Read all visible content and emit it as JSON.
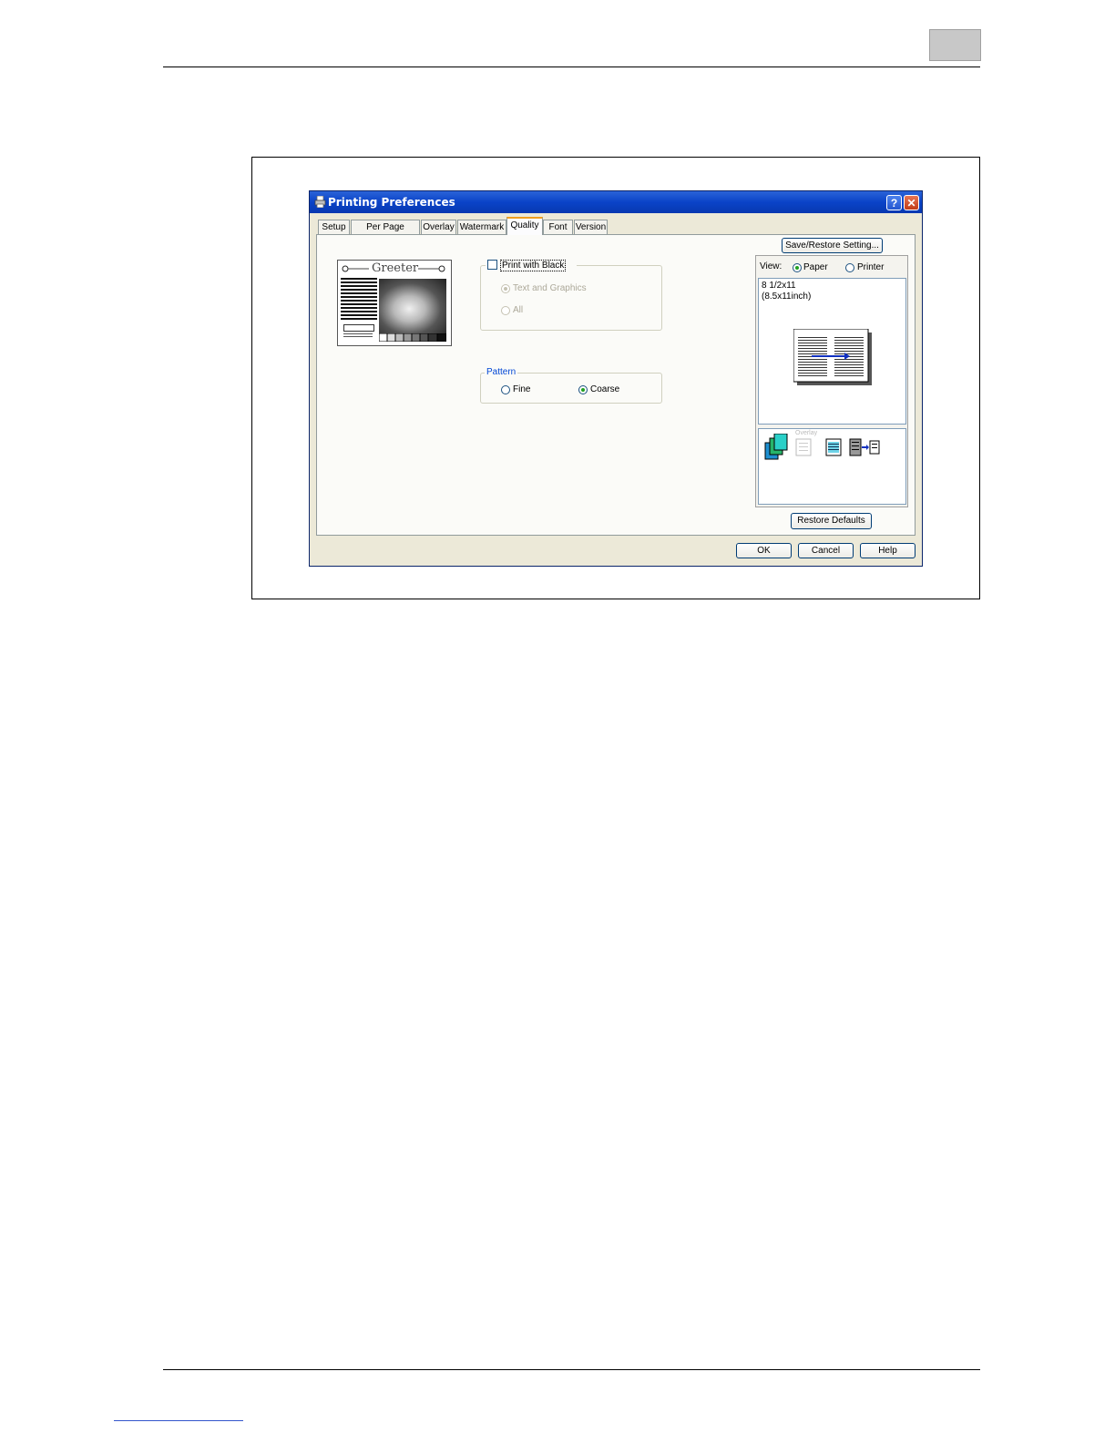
{
  "dialog": {
    "title": "Printing Preferences",
    "help_glyph": "?",
    "close_glyph": "✕"
  },
  "tabs": [
    {
      "label": "Setup"
    },
    {
      "label": "Per Page Setting"
    },
    {
      "label": "Overlay"
    },
    {
      "label": "Watermark"
    },
    {
      "label": "Quality",
      "active": true
    },
    {
      "label": "Font"
    },
    {
      "label": "Version"
    }
  ],
  "preview_sample": {
    "heading": "Greeter"
  },
  "quality": {
    "print_with_black": {
      "label": "Print with Black",
      "checked": false
    },
    "black_options": [
      {
        "label": "Text and Graphics",
        "selected": true,
        "enabled": false
      },
      {
        "label": "All",
        "selected": false,
        "enabled": false
      }
    ],
    "pattern": {
      "legend": "Pattern",
      "options": [
        {
          "label": "Fine",
          "selected": false
        },
        {
          "label": "Coarse",
          "selected": true
        }
      ]
    }
  },
  "right_panel": {
    "save_restore_label": "Save/Restore Setting...",
    "view_label": "View:",
    "view_options": [
      {
        "label": "Paper",
        "selected": true
      },
      {
        "label": "Printer",
        "selected": false
      }
    ],
    "paper_size_line1": "8 1/2x11",
    "paper_size_line2": "(8.5x11inch)",
    "overlay_caption": "Overlay",
    "restore_defaults_label": "Restore Defaults"
  },
  "footer_buttons": {
    "ok": "OK",
    "cancel": "Cancel",
    "help": "Help"
  },
  "colors": {
    "titlebar": "#0a43c8",
    "radio_selected": "#21a121",
    "dialog_face": "#ece9d8"
  }
}
